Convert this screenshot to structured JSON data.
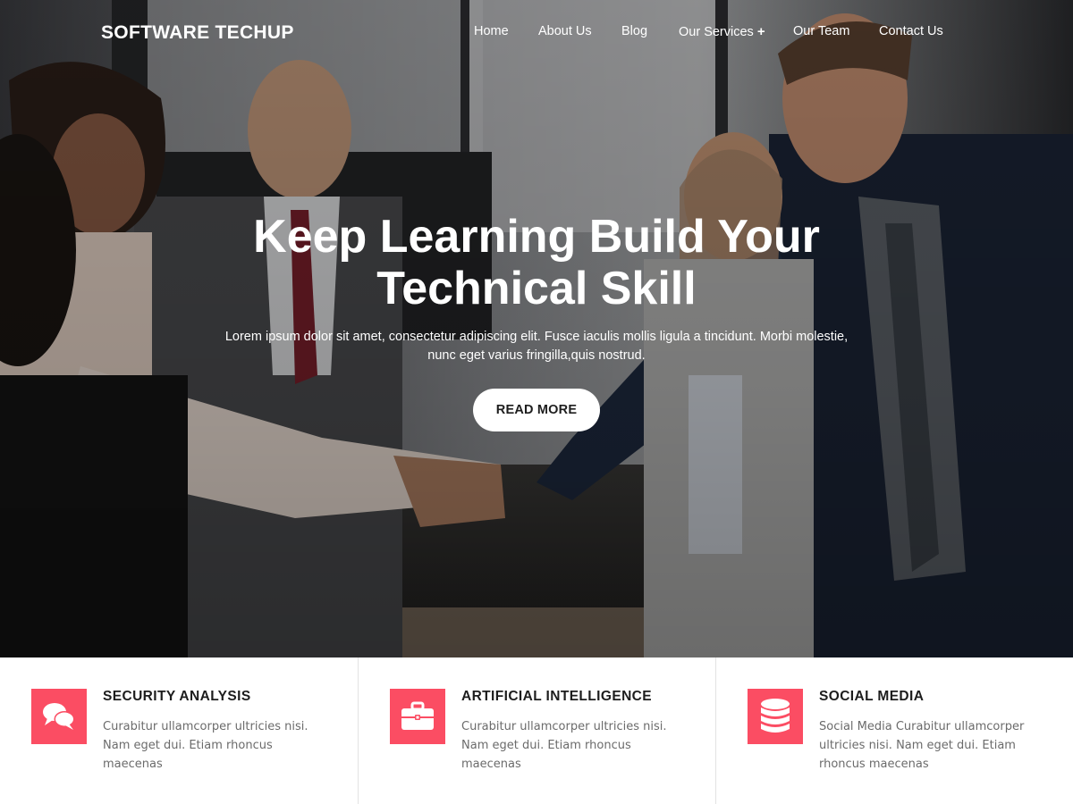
{
  "header": {
    "logo": "SOFTWARE TECHUP",
    "nav": [
      {
        "label": "Home"
      },
      {
        "label": "About Us"
      },
      {
        "label": "Blog"
      },
      {
        "label": "Our Services",
        "submenu_indicator": "+"
      },
      {
        "label": "Our Team"
      },
      {
        "label": "Contact Us"
      }
    ]
  },
  "hero": {
    "title_line1": "Keep Learning Build Your",
    "title_line2": "Technical Skill",
    "description": "Lorem ipsum dolor sit amet, consectetur adipiscing elit. Fusce iaculis mollis ligula a tincidunt. Morbi molestie, nunc eget varius fringilla,quis nostrud.",
    "button_label": "READ MORE"
  },
  "features": [
    {
      "icon": "chat-bubbles-icon",
      "title": "SECURITY ANALYSIS",
      "text": "Curabitur ullamcorper ultricies nisi. Nam eget dui. Etiam rhoncus maecenas"
    },
    {
      "icon": "briefcase-icon",
      "title": "ARTIFICIAL INTELLIGENCE",
      "text": "Curabitur ullamcorper ultricies nisi. Nam eget dui. Etiam rhoncus maecenas"
    },
    {
      "icon": "database-icon",
      "title": "SOCIAL MEDIA",
      "text": "Social Media Curabitur ullamcorper ultricies nisi. Nam eget dui. Etiam rhoncus maecenas"
    }
  ],
  "colors": {
    "accent": "#fb4d63",
    "hero_overlay": "#000000",
    "feature_title": "#1d1d1d",
    "feature_text": "#6b6b6b"
  }
}
